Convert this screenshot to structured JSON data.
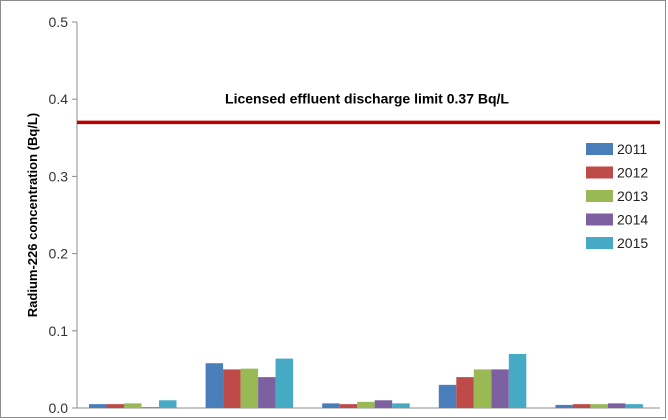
{
  "chart_data": {
    "type": "bar",
    "title": "",
    "xlabel": "",
    "ylabel": "Radium-226 concentration (Bq/L)",
    "ylim": [
      0,
      0.5
    ],
    "yticks": [
      "0.0",
      "0.1",
      "0.2",
      "0.3",
      "0.4",
      "0.5"
    ],
    "grid": false,
    "legend_position": "right",
    "categories": [
      "",
      "",
      "",
      "",
      ""
    ],
    "series": [
      {
        "name": "2011",
        "color": "#4a7ebb",
        "values": [
          0.005,
          0.058,
          0.006,
          0.03,
          0.004
        ]
      },
      {
        "name": "2012",
        "color": "#be4b48",
        "values": [
          0.005,
          0.05,
          0.005,
          0.04,
          0.005
        ]
      },
      {
        "name": "2013",
        "color": "#98b954",
        "values": [
          0.006,
          0.051,
          0.008,
          0.05,
          0.005
        ]
      },
      {
        "name": "2014",
        "color": "#7d60a0",
        "values": [
          0.001,
          0.04,
          0.01,
          0.05,
          0.006
        ]
      },
      {
        "name": "2015",
        "color": "#46aac5",
        "values": [
          0.01,
          0.064,
          0.006,
          0.07,
          0.005
        ]
      }
    ],
    "reference_line": {
      "value": 0.37,
      "label": "Licensed effluent discharge limit 0.37 Bq/L",
      "color": "#c00000"
    }
  }
}
